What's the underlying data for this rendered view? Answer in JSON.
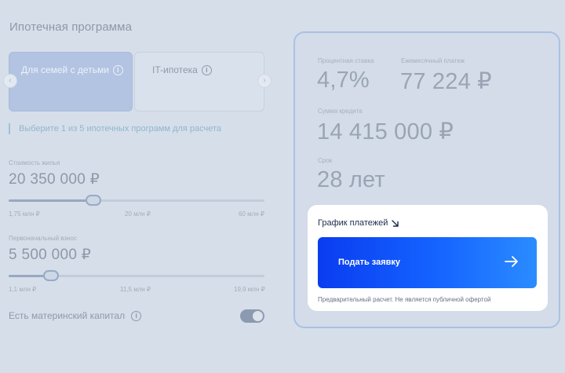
{
  "section_title": "Ипотечная программа",
  "programs": {
    "tabs": [
      {
        "label": "Для семей с детьми",
        "active": true
      },
      {
        "label": "IT-ипотека",
        "active": false
      }
    ],
    "prev_arrow": "‹",
    "next_arrow": "›"
  },
  "hint": "Выберите 1 из 5 ипотечных программ для расчета",
  "property_cost": {
    "label": "Стоимость жилья",
    "value": "20 350 000 ₽",
    "slider_fraction": 0.33,
    "ticks": [
      "1,75 млн ₽",
      "20 млн ₽",
      "60 млн ₽"
    ]
  },
  "down_payment": {
    "label": "Первоначальный взнос",
    "value": "5 500 000 ₽",
    "slider_fraction": 0.165,
    "ticks": [
      "1,1 млн ₽",
      "11,5 млн ₽",
      "19,9 млн ₽"
    ]
  },
  "maternity_capital": {
    "label": "Есть материнский капитал",
    "enabled": true
  },
  "result": {
    "rate_label": "Процентная ставка",
    "rate_value": "4,7%",
    "payment_label": "Ежемесячный платеж",
    "payment_value": "77 224 ₽",
    "loan_label": "Сумма кредита",
    "loan_value": "14 415 000 ₽",
    "term_label": "Срок",
    "term_value": "28 лет"
  },
  "cta": {
    "schedule_link": "График платежей",
    "apply_button": "Подать заявку",
    "disclaimer": "Предварительный расчет. Не является публичной офертой"
  },
  "icons": {
    "info": "info-icon",
    "arrow_down_right": "arrow-down-right-icon",
    "arrow_right": "arrow-right-icon"
  },
  "colors": {
    "accent": "#1564ff",
    "overlay_bg": "#d6dee9"
  }
}
